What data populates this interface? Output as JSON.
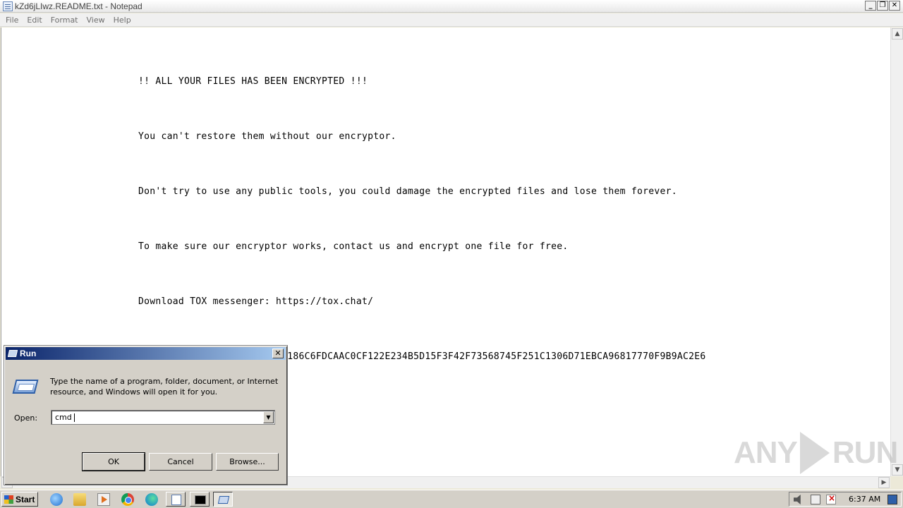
{
  "notepad": {
    "title": "kZd6jLIwz.README.txt - Notepad",
    "menu": [
      "File",
      "Edit",
      "Format",
      "View",
      "Help"
    ],
    "lines": [
      "!! ALL YOUR FILES HAS BEEN ENCRYPTED !!!",
      "You can't restore them without our encryptor.",
      "Don't try to use any public tools, you could damage the encrypted files and lose them forever.",
      "To make sure our encryptor works, contact us and encrypt one file for free.",
      "Download TOX messenger: https://tox.chat/",
      "Add friend in TOX, ID: 36F186C6FDCAAC0CF122E234B5D15F3F42F73568745F251C1306D71EBCA96817770F9B9AC2E6"
    ]
  },
  "run_dialog": {
    "title": "Run",
    "description": "Type the name of a program, folder, document, or Internet resource, and Windows will open it for you.",
    "open_label": "Open:",
    "input_value": "cmd",
    "ok_label": "OK",
    "cancel_label": "Cancel",
    "browse_label": "Browse..."
  },
  "taskbar": {
    "start_label": "Start",
    "clock": "6:37 AM"
  },
  "watermark": {
    "left": "ANY",
    "right": "RUN"
  },
  "icons": {
    "taskbar_quicklaunch": [
      "ie-icon",
      "folder-icon",
      "media-player-icon",
      "chrome-icon",
      "edge-icon"
    ],
    "taskbar_tasks": [
      "notepad-icon",
      "cmd-icon",
      "run-icon"
    ]
  }
}
